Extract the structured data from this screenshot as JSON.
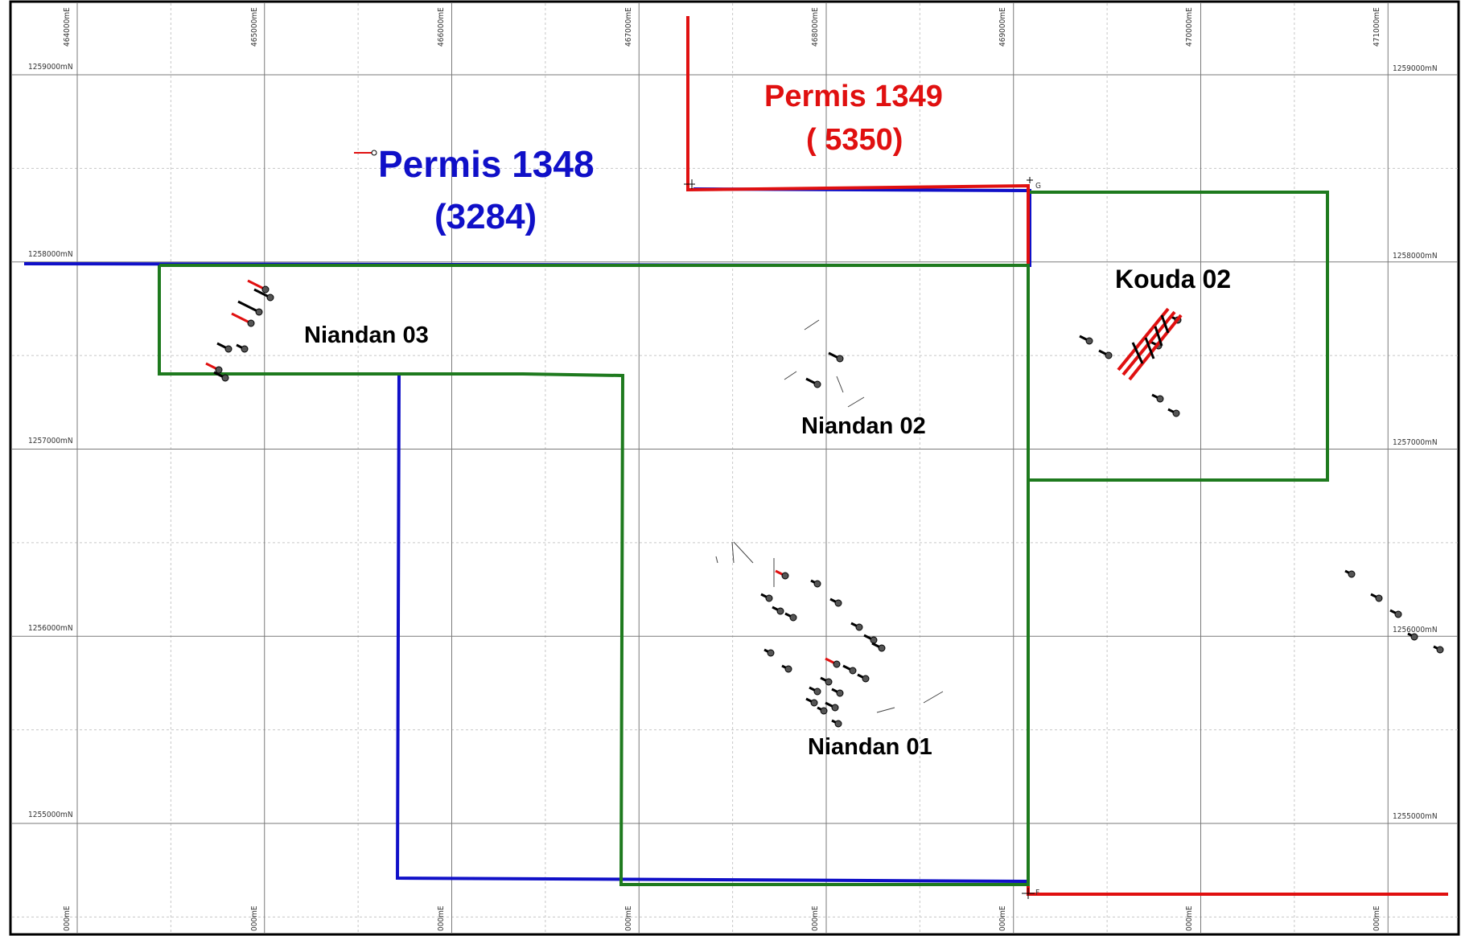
{
  "map": {
    "easting_labels_top": [
      "464000mE",
      "465000mE",
      "466000mE",
      "467000mE",
      "468000mE",
      "469000mE",
      "470000mE",
      "471000mE"
    ],
    "easting_labels_bottom": [
      "000mE",
      "000mE",
      "000mE",
      "000mE",
      "000mE",
      "000mE",
      "000mE",
      "000mE"
    ],
    "northing_labels_left": [
      "1259000mN",
      "1258000mN",
      "1257000mN",
      "1256000mN",
      "1255000mN"
    ],
    "northing_labels_right": [
      "1259000mN",
      "1258000mN",
      "1257000mN",
      "1256000mN",
      "1255000mN"
    ],
    "colors": {
      "permis_1348": "#1010c8",
      "permis_1349": "#e01010",
      "prospect_boundary": "#1e7a1e",
      "grid_major": "#7a7a7a",
      "grid_minor": "#c8c8c8",
      "drillhole": "#000000",
      "trace": "#e01010"
    },
    "permits": [
      {
        "id": "permis-1348",
        "name": "Permis 1348",
        "number": "(3284)"
      },
      {
        "id": "permis-1349",
        "name": "Permis 1349",
        "number": "( 5350)"
      }
    ],
    "prospects": [
      {
        "id": "niandan-03",
        "name": "Niandan 03"
      },
      {
        "id": "niandan-02",
        "name": "Niandan 02"
      },
      {
        "id": "niandan-01",
        "name": "Niandan 01"
      },
      {
        "id": "kouda-02",
        "name": "Kouda 02"
      }
    ],
    "corner_markers": [
      "G",
      "F"
    ]
  }
}
